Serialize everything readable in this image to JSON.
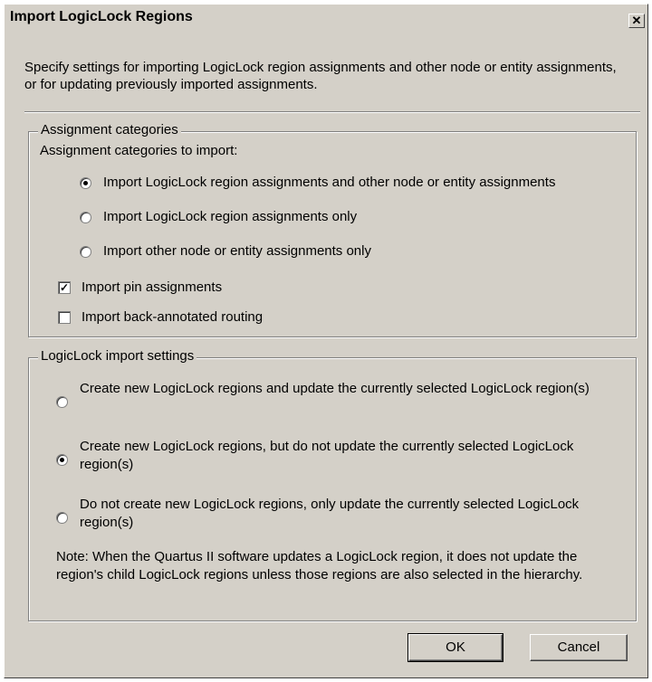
{
  "window": {
    "title": "Import LogicLock Regions",
    "close_glyph": "✕"
  },
  "description": "Specify settings for importing LogicLock region assignments and other node or entity assignments, or for updating previously imported assignments.",
  "assignment_group": {
    "legend": "Assignment categories",
    "prompt": "Assignment categories to import:",
    "options": [
      {
        "label": "Import LogicLock region assignments and other node or entity assignments",
        "selected": true
      },
      {
        "label": "Import LogicLock region assignments only",
        "selected": false
      },
      {
        "label": "Import other node or entity assignments only",
        "selected": false
      }
    ],
    "checkboxes": [
      {
        "label": "Import pin assignments",
        "checked": true
      },
      {
        "label": "Import back-annotated routing",
        "checked": false
      }
    ]
  },
  "import_settings_group": {
    "legend": "LogicLock import settings",
    "options": [
      {
        "label": "Create new LogicLock regions and update the currently selected LogicLock region(s)",
        "selected": false
      },
      {
        "label": "Create new LogicLock regions, but do not update the currently selected LogicLock region(s)",
        "selected": true
      },
      {
        "label": "Do not create new LogicLock regions, only update the currently selected LogicLock region(s)",
        "selected": false
      }
    ],
    "note": "Note: When the Quartus II software updates a LogicLock region, it does not update the region's child LogicLock regions unless those regions are also selected in the hierarchy."
  },
  "buttons": {
    "ok": "OK",
    "cancel": "Cancel"
  },
  "icons": {
    "close": "close-icon",
    "check": "checkmark-icon"
  }
}
